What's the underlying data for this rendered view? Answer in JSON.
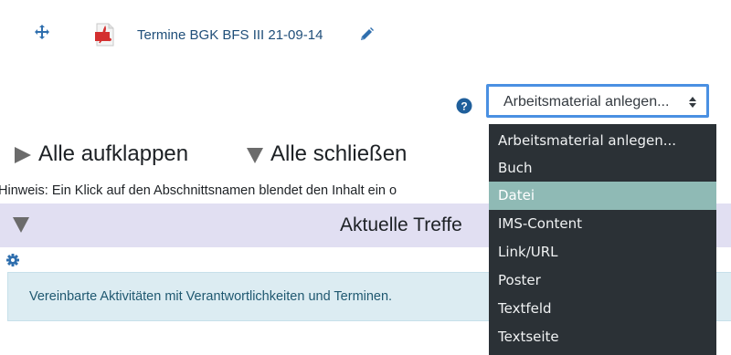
{
  "file": {
    "name": "Termine BGK BFS III 21-09-14",
    "icon": "pdf-icon"
  },
  "select": {
    "value": "Arbeitsmaterial anlegen...",
    "options": [
      "Arbeitsmaterial anlegen...",
      "Buch",
      "Datei",
      "IMS-Content",
      "Link/URL",
      "Poster",
      "Textfeld",
      "Textseite"
    ],
    "highlighted": "Datei"
  },
  "controls": {
    "expand_all": "Alle aufklappen",
    "collapse_all": "Alle schließen"
  },
  "hint": "Hinweis: Ein Klick auf den Abschnittsnamen blendet den Inhalt ein o",
  "section": {
    "title": "Aktuelle Treffe"
  },
  "info": "Vereinbarte Aktivitäten mit Verantwortlichkeiten und Terminen.",
  "colors": {
    "accent": "#4a90e2",
    "section_bg": "#e1dff2",
    "info_bg": "#dcecf2",
    "dropdown_bg": "#2b3136",
    "dropdown_highlight": "#8fbab5"
  }
}
